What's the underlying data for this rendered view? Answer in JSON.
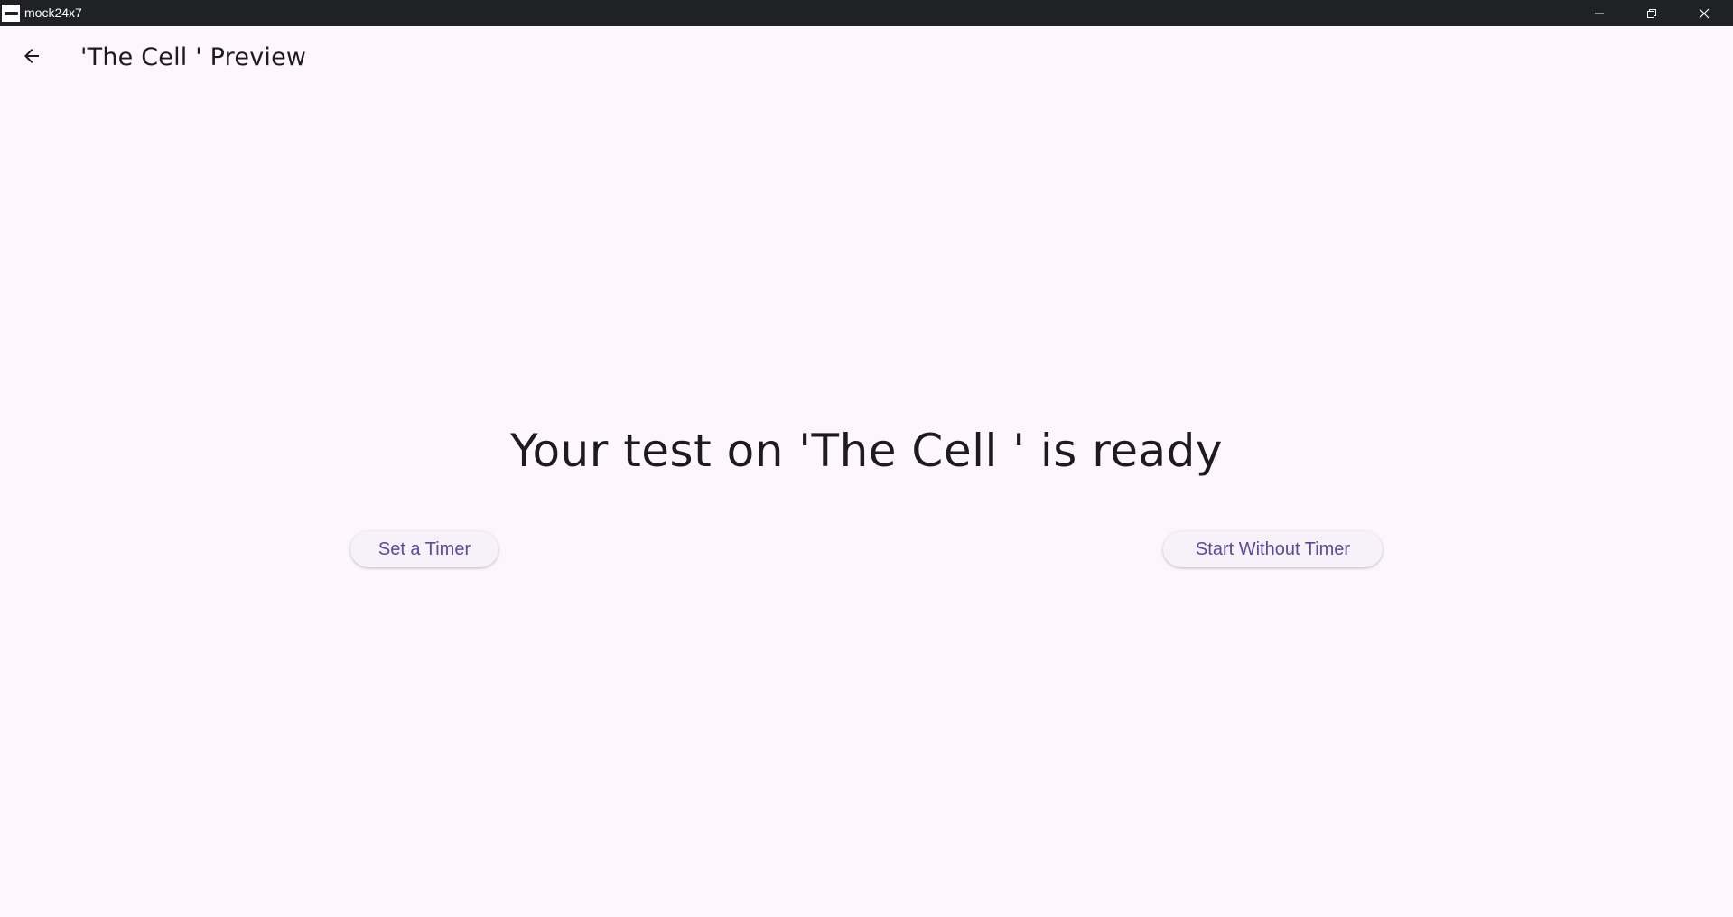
{
  "window": {
    "title": "mock24x7",
    "controls": {
      "minimize": "minimize-icon",
      "maximize": "restore-icon",
      "close": "close-icon"
    }
  },
  "appbar": {
    "back_icon": "arrow-left-icon",
    "title": "'The Cell ' Preview"
  },
  "main": {
    "headline": "Your test on 'The Cell ' is ready",
    "set_timer_label": "Set a Timer",
    "start_without_timer_label": "Start Without Timer"
  },
  "colors": {
    "background": "#fdf7fd",
    "titlebar": "#1f2124",
    "button_text": "#5a4a9c",
    "button_bg": "#f7f2fa",
    "text": "#1d1b20"
  }
}
